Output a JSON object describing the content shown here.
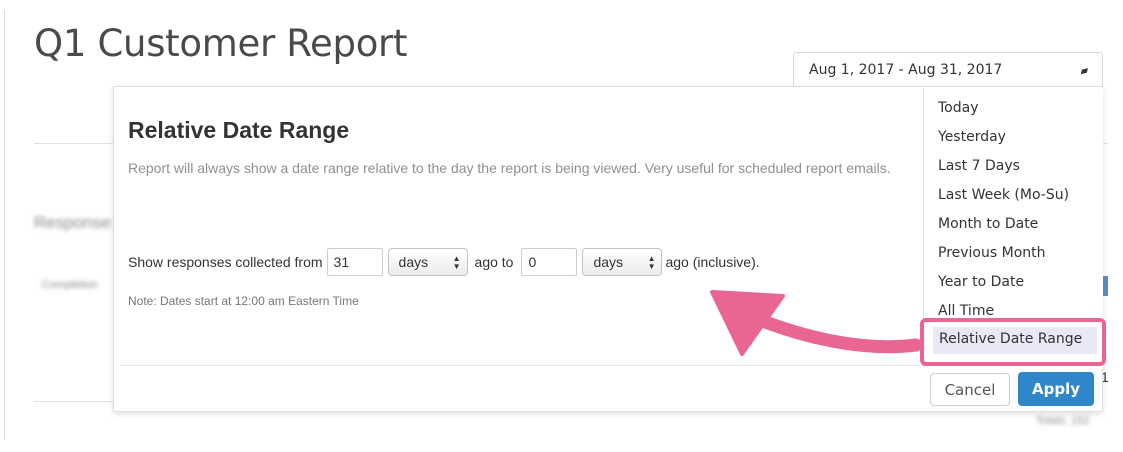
{
  "page": {
    "title": "Q1 Customer Report"
  },
  "background": {
    "blurred_heading": "Responses",
    "blurred_row_label": "Completion",
    "blurred_count": "1",
    "blurred_totals": "Totals: 152"
  },
  "date_picker": {
    "value": "Aug 1, 2017 - Aug 31, 2017",
    "icon": "pencil-caret-icon"
  },
  "modal": {
    "title": "Relative Date Range",
    "description": "Report will always show a date range relative to the day the report is being viewed. Very useful for scheduled report emails.",
    "form": {
      "lead_text": "Show responses collected from",
      "from_value": "31",
      "from_unit": "days",
      "middle_text": "ago to",
      "to_value": "0",
      "to_unit": "days",
      "trail_text": "ago (inclusive)."
    },
    "note": "Note: Dates start at 12:00 am Eastern Time"
  },
  "range_options": {
    "items": [
      "Today",
      "Yesterday",
      "Last 7 Days",
      "Last Week (Mo-Su)",
      "Month to Date",
      "Previous Month",
      "Year to Date",
      "All Time",
      "Relative Date Range"
    ],
    "selected": "Relative Date Range"
  },
  "buttons": {
    "cancel": "Cancel",
    "apply": "Apply"
  },
  "colors": {
    "annotation": "#e8668f",
    "apply_button": "#2f86c8",
    "selected_item_bg": "#e8e8f6"
  }
}
